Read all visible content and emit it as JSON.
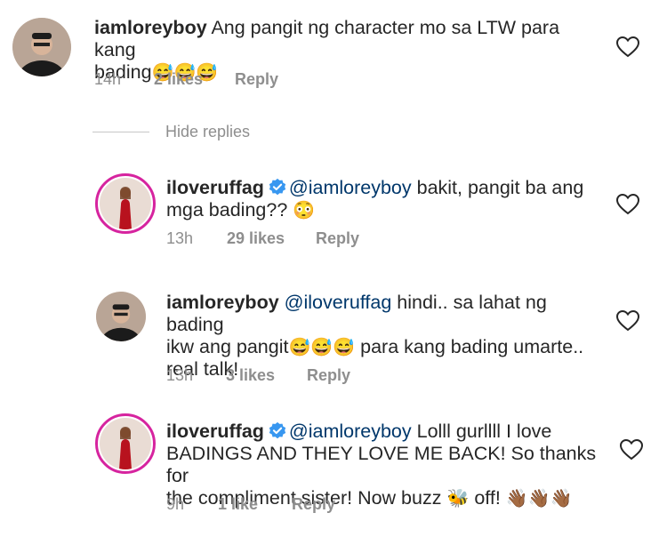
{
  "comments": [
    {
      "username": "iamloreyboy",
      "mention": "",
      "text_line1": " Ang pangit ng character mo sa LTW para kang",
      "text_line2": "bading",
      "emojis_line2": "😅😅😅",
      "time": "14h",
      "likes": "2 likes",
      "reply": "Reply"
    },
    {
      "username": "iloveruffag",
      "verified": true,
      "mention": "@iamloreyboy",
      "text_line1": " bakit, pangit ba ang",
      "text_line2": "mga bading??",
      "emojis_line2": "😳",
      "time": "13h",
      "likes": "29 likes",
      "reply": "Reply"
    },
    {
      "username": "iamloreyboy",
      "mention": "@iloveruffag",
      "text_line1": " hindi.. sa lahat ng bading",
      "text_line2a": "ikw ang pangit",
      "emojis_line2": "😅😅😅",
      "text_line2b": " para kang bading umarte..",
      "text_line3": "real talk!",
      "time": "13h",
      "likes": "3 likes",
      "reply": "Reply"
    },
    {
      "username": "iloveruffag",
      "verified": true,
      "mention": "@iamloreyboy",
      "text_line1": " Lolll gurllll I love",
      "text_line2": "BADINGS AND THEY LOVE ME BACK! So thanks for",
      "text_line3a": "the compliment sister! Now buzz ",
      "bee": "🐝",
      "text_line3b": " off! ",
      "emojis_line3": "👋🏾👋🏾👋🏾",
      "time": "9h",
      "likes": "1 like",
      "reply": "Reply"
    }
  ],
  "hide_replies": "Hide replies",
  "colors": {
    "text": "#262626",
    "muted": "#8e8e8e",
    "mention": "#00376b",
    "verified": "#3897f0",
    "story_ring": "#d6249f"
  },
  "icons": [
    "heart-icon",
    "verified-badge-icon",
    "avatar"
  ]
}
